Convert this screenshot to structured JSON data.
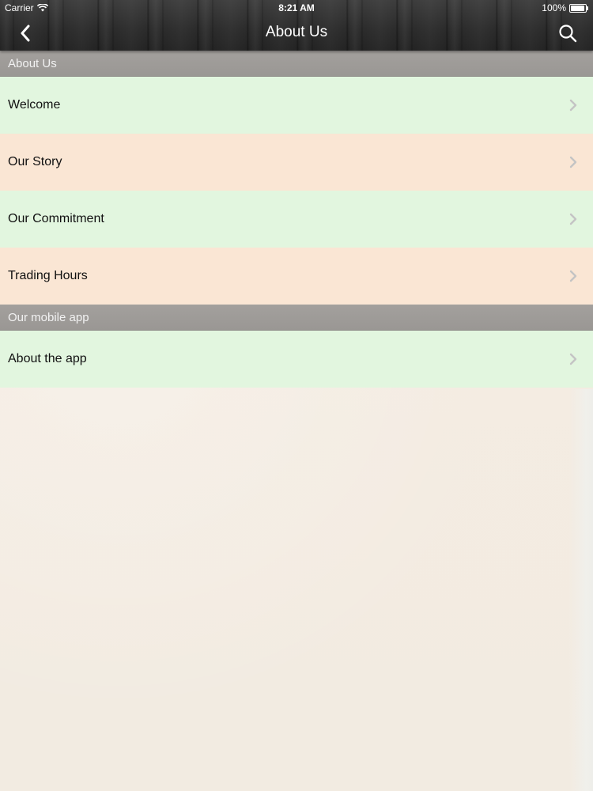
{
  "status_bar": {
    "carrier": "Carrier",
    "time": "8:21 AM",
    "battery": "100%"
  },
  "nav": {
    "title": "About Us",
    "back_icon": "chevron-left-icon",
    "search_icon": "search-icon"
  },
  "sections": [
    {
      "header": "About Us",
      "items": [
        {
          "label": "Welcome",
          "color": "#e2f6df"
        },
        {
          "label": "Our Story",
          "color": "#fae6d4"
        },
        {
          "label": "Our Commitment",
          "color": "#e2f6df"
        },
        {
          "label": "Trading Hours",
          "color": "#fae6d4"
        }
      ]
    },
    {
      "header": "Our mobile app",
      "items": [
        {
          "label": "About the app",
          "color": "#e2f6df"
        }
      ]
    }
  ],
  "colors": {
    "header_bg": "#2c2c2c",
    "section_header_bg": "#9d9a97",
    "row_green": "#e2f6df",
    "row_peach": "#fae6d4",
    "content_bg": "#f4ede3",
    "chevron": "#c4c4c4"
  }
}
